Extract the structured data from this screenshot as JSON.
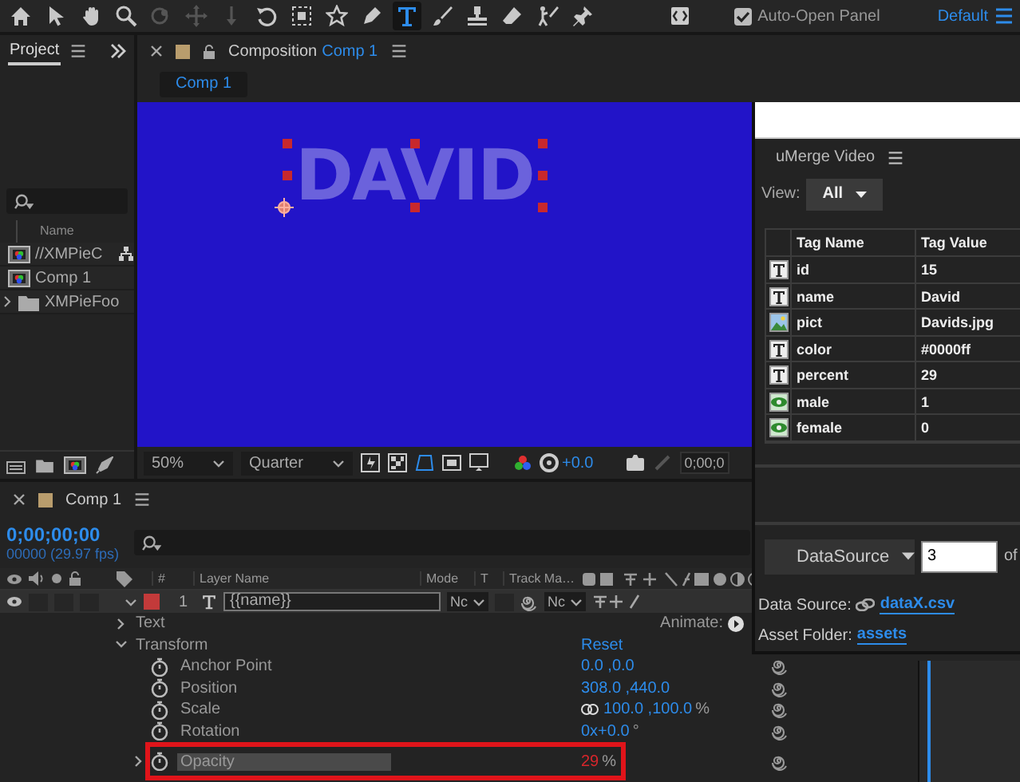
{
  "toolbar": {
    "tools": [
      {
        "kind": "home",
        "selected": false,
        "disabled": false
      },
      {
        "kind": "selection",
        "selected": false,
        "disabled": false
      },
      {
        "kind": "hand",
        "selected": false,
        "disabled": false
      },
      {
        "kind": "zoom",
        "selected": false,
        "disabled": false
      },
      {
        "kind": "orbit",
        "selected": false,
        "disabled": true
      },
      {
        "kind": "pan",
        "selected": false,
        "disabled": true
      },
      {
        "kind": "dolly",
        "selected": false,
        "disabled": true
      },
      {
        "kind": "rotation",
        "selected": false,
        "disabled": false
      },
      {
        "kind": "region",
        "selected": false,
        "disabled": false
      },
      {
        "kind": "shape",
        "selected": false,
        "disabled": false
      },
      {
        "kind": "pen",
        "selected": false,
        "disabled": false
      },
      {
        "kind": "type",
        "selected": true,
        "disabled": false
      },
      {
        "kind": "brush",
        "selected": false,
        "disabled": false
      },
      {
        "kind": "stamp",
        "selected": false,
        "disabled": false
      },
      {
        "kind": "eraser",
        "selected": false,
        "disabled": false
      },
      {
        "kind": "roto",
        "selected": false,
        "disabled": false
      },
      {
        "kind": "pin",
        "selected": false,
        "disabled": false
      }
    ],
    "auto_open_panel": {
      "label": "Auto-Open Panel",
      "checked": true
    },
    "workspace": "Default"
  },
  "project_panel": {
    "tab": "Project",
    "column": "Name",
    "items": [
      {
        "name": "//XMPieC",
        "kind": "comp",
        "has_dependencies": true
      },
      {
        "name": "Comp 1",
        "kind": "comp",
        "has_dependencies": false
      },
      {
        "name": "XMPieFoo",
        "kind": "folder",
        "has_dependencies": false
      }
    ]
  },
  "composition": {
    "panel_title": "Composition",
    "comp_name": "Comp 1",
    "tab": "Comp 1",
    "viewer": {
      "text": "DAVID"
    },
    "zoom": "50%",
    "resolution": "Quarter",
    "exposure": "+0.0",
    "timecode": "0;00;0"
  },
  "timeline": {
    "tab": "Comp 1",
    "timecode": "0;00;00;00",
    "frame_info": "00000 (29.97 fps)",
    "columns": [
      "#",
      "Layer Name",
      "Mode",
      "T",
      "Track Ma…"
    ],
    "layer": {
      "number": "1",
      "name": "{{name}}",
      "mode": "Nc",
      "track_matte": "Nc",
      "children": [
        {
          "name": "Text",
          "expanded": false,
          "action": "Animate:"
        },
        {
          "name": "Transform",
          "expanded": true,
          "value": "Reset",
          "children": [
            {
              "name": "Anchor Point",
              "value": "0.0 ,0.0",
              "selected": false,
              "highlighted": false,
              "has_expression": false,
              "constrained": false
            },
            {
              "name": "Position",
              "value": "308.0 ,440.0",
              "selected": false,
              "highlighted": false,
              "has_expression": false,
              "constrained": false
            },
            {
              "name": "Scale",
              "value": "100.0 ,100.0",
              "unit": "%",
              "selected": false,
              "highlighted": false,
              "has_expression": false,
              "constrained": true
            },
            {
              "name": "Rotation",
              "value": "0x+0.0",
              "unit": "°",
              "selected": false,
              "highlighted": false,
              "has_expression": false,
              "constrained": false
            },
            {
              "name": "Opacity",
              "value": "29",
              "unit": "%",
              "selected": true,
              "highlighted": true,
              "has_expression": true,
              "constrained": false
            }
          ]
        }
      ]
    }
  },
  "umerge_panel": {
    "title": "uMerge Video",
    "view": {
      "label": "View:",
      "value": "All"
    },
    "table": {
      "columns": [
        "Tag Name",
        "Tag Value"
      ],
      "rows": [
        {
          "kind": "text",
          "name": "id",
          "value": "15"
        },
        {
          "kind": "text",
          "name": "name",
          "value": "David"
        },
        {
          "kind": "image",
          "name": "pict",
          "value": "Davids.jpg"
        },
        {
          "kind": "text",
          "name": "color",
          "value": "#0000ff"
        },
        {
          "kind": "text",
          "name": "percent",
          "value": "29"
        },
        {
          "kind": "visibility",
          "name": "male",
          "value": "1"
        },
        {
          "kind": "visibility",
          "name": "female",
          "value": "0"
        }
      ]
    },
    "source_button": "DataSource",
    "record": "3",
    "record_of": "of",
    "data_source": {
      "label": "Data Source:",
      "link": "dataX.csv"
    },
    "asset_folder": {
      "label": "Asset Folder:",
      "link": "assets"
    }
  }
}
